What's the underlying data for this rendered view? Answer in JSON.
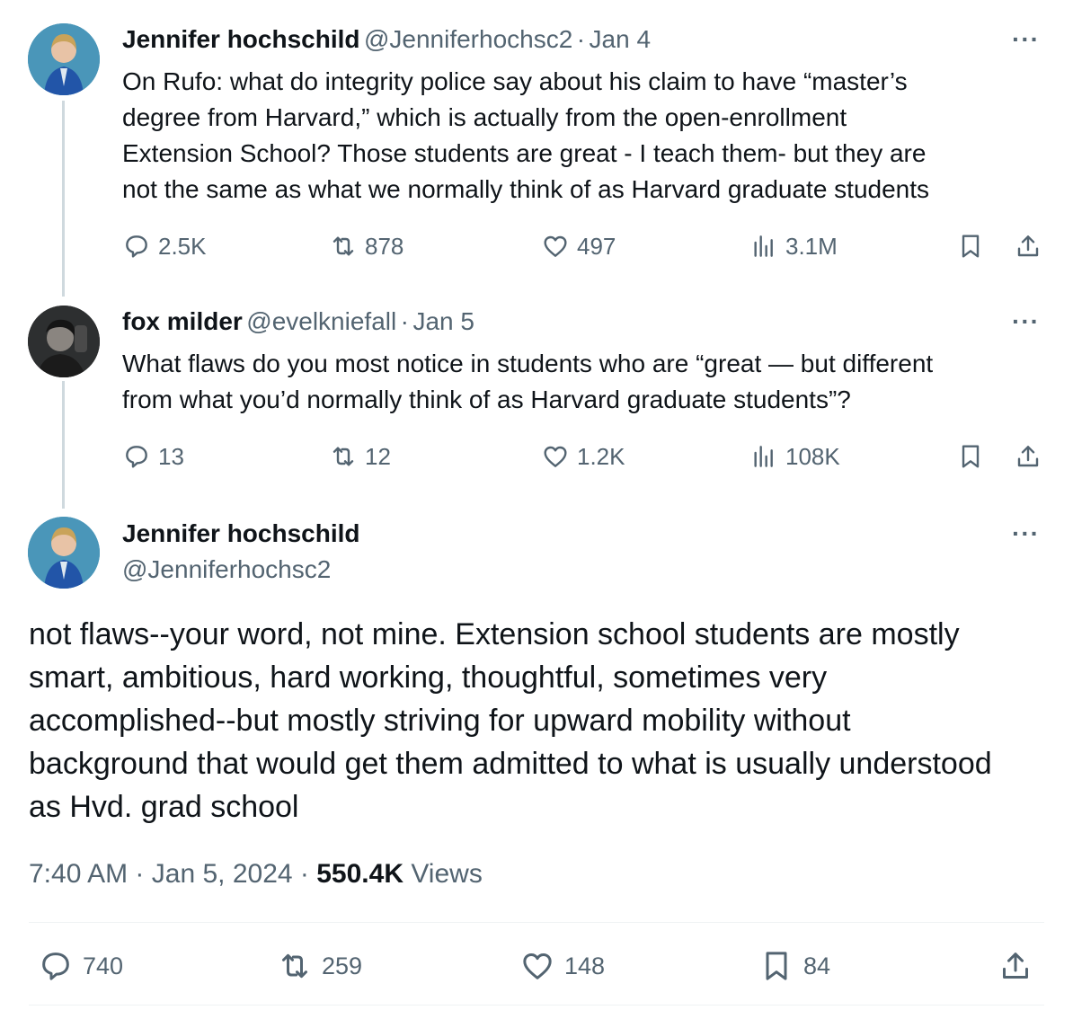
{
  "tweet1": {
    "name": "Jennifer hochschild",
    "handle": "@Jenniferhochsc2",
    "date": "Jan 4",
    "text_lines": [
      "On Rufo: what do integrity police say about his claim to have “master’s",
      "degree from Harvard,” which is actually from the open-enrollment",
      "Extension School? Those students are great - I teach them- but they are",
      "not the same as what we normally think of as Harvard graduate students"
    ],
    "replies": "2.5K",
    "reposts": "878",
    "likes": "497",
    "views": "3.1M"
  },
  "tweet2": {
    "name": "fox milder",
    "handle": "@evelkniefall",
    "date": "Jan 5",
    "text_lines": [
      "What flaws do you most notice in students who are “great — but different",
      "from what you’d normally think of as Harvard graduate students”?"
    ],
    "replies": "13",
    "reposts": "12",
    "likes": "1.2K",
    "views": "108K"
  },
  "main": {
    "name": "Jennifer hochschild",
    "handle": "@Jenniferhochsc2",
    "text_lines": [
      "not flaws--your word, not mine. Extension school students are mostly",
      "smart, ambitious, hard working, thoughtful, sometimes very",
      "accomplished--but mostly striving for upward mobility without",
      "background that would get them admitted to what is usually understood",
      "as Hvd. grad school"
    ],
    "time": "7:40 AM",
    "date": "Jan 5, 2024",
    "views_count": "550.4K",
    "views_label": "Views",
    "replies": "740",
    "reposts": "259",
    "likes": "148",
    "bookmarks": "84"
  },
  "ui": {
    "more": "···",
    "separator": "·"
  },
  "colors": {
    "text": "#0f1419",
    "secondary": "#536471",
    "thread_line": "#cfd9de",
    "divider": "#eff3f4"
  }
}
